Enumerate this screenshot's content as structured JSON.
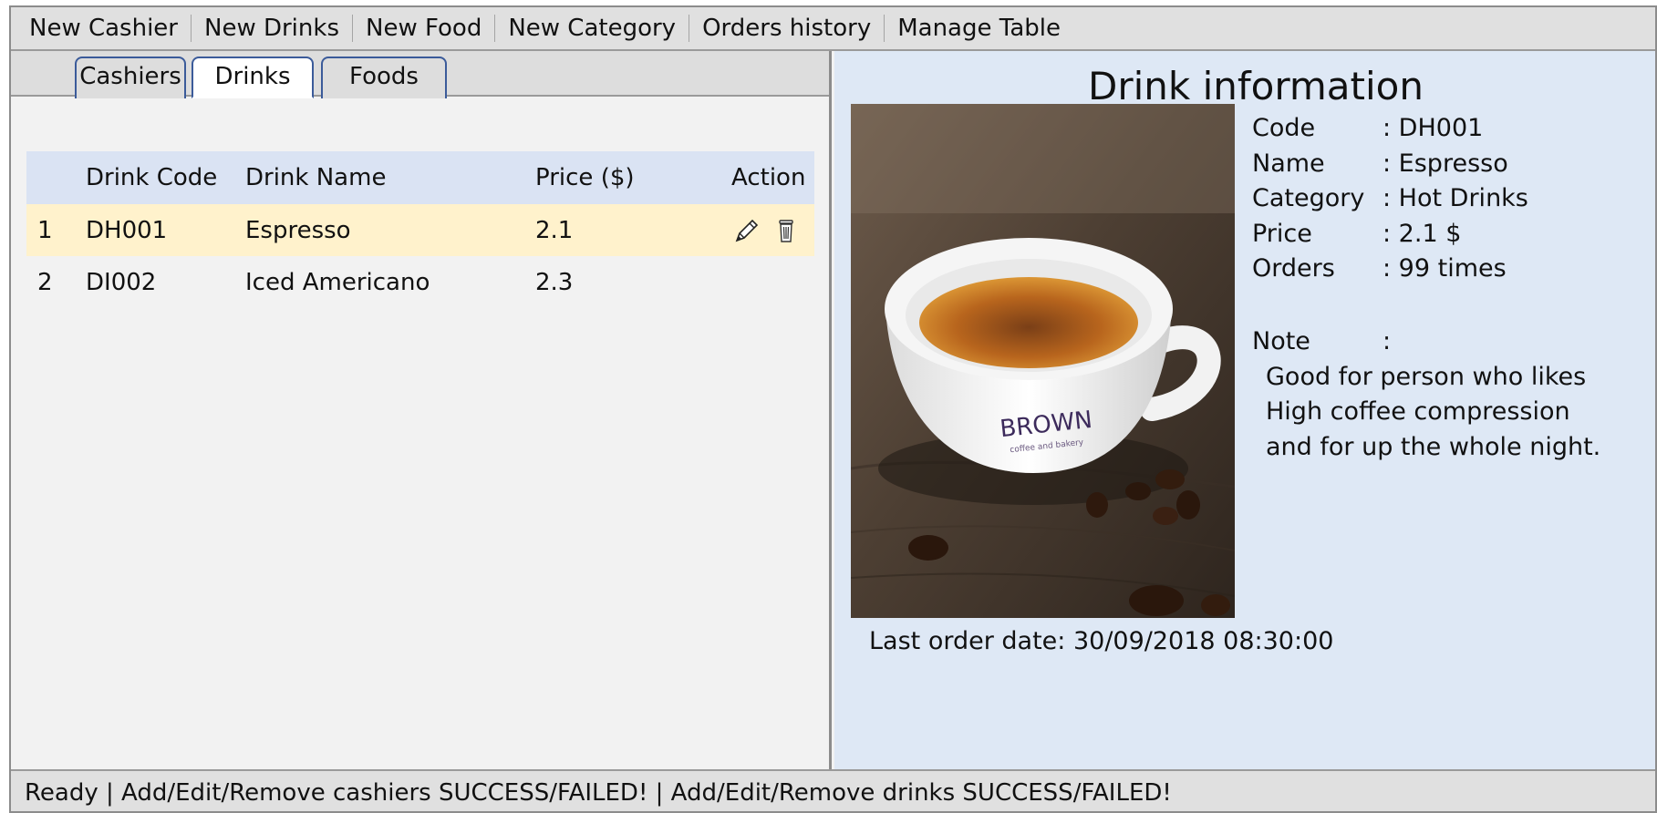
{
  "menu": {
    "items": [
      {
        "label": "New Cashier"
      },
      {
        "label": "New Drinks"
      },
      {
        "label": "New Food"
      },
      {
        "label": "New Category"
      },
      {
        "label": "Orders history"
      },
      {
        "label": "Manage Table"
      }
    ]
  },
  "tabs": {
    "cashiers": "Cashiers",
    "drinks": "Drinks",
    "foods": "Foods",
    "active": "Drinks"
  },
  "table": {
    "headers": {
      "code": "Drink Code",
      "name": "Drink Name",
      "price": "Price ($)",
      "action": "Action"
    },
    "rows": [
      {
        "index": "1",
        "code": "DH001",
        "name": "Espresso",
        "price": "2.1",
        "selected": true
      },
      {
        "index": "2",
        "code": "DI002",
        "name": "Iced Americano",
        "price": "2.3",
        "selected": false
      }
    ],
    "action_icons": [
      "pencil-icon",
      "trash-icon"
    ]
  },
  "detail": {
    "title": "Drink information",
    "fields": {
      "code": {
        "label": "Code",
        "value": ": DH001"
      },
      "name": {
        "label": "Name",
        "value": ": Espresso"
      },
      "category": {
        "label": "Category",
        "value": ": Hot Drinks"
      },
      "price": {
        "label": "Price",
        "value": ": 2.1 $"
      },
      "orders": {
        "label": "Orders",
        "value": ": 99 times"
      }
    },
    "note": {
      "label": "Note",
      "separator": ":",
      "lines": [
        "Good for person who likes",
        "High coffee compression",
        "and for up the whole night."
      ]
    },
    "photo_text": "BROWN",
    "photo_subtext": "coffee and bakery",
    "last_order": "Last order date: 30/09/2018 08:30:00"
  },
  "status": {
    "text": "Ready | Add/Edit/Remove cashiers SUCCESS/FAILED! | Add/Edit/Remove drinks SUCCESS/FAILED!"
  },
  "colors": {
    "table_header": "#dae3f3",
    "selected_row": "#fff2cc",
    "right_panel": "#dee8f5",
    "tab_border": "#3b5b9a"
  }
}
